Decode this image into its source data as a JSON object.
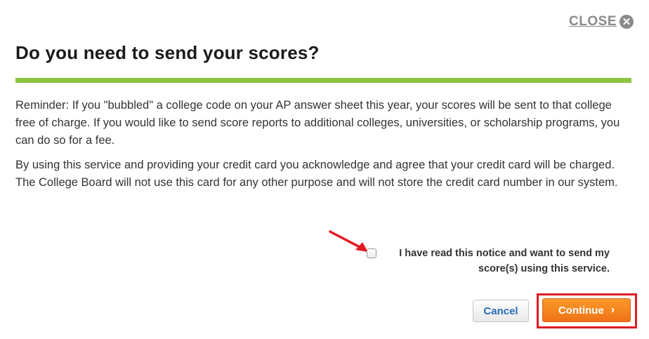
{
  "dialog": {
    "close_label": "CLOSE",
    "close_icon": "close-circle-icon",
    "title": "Do you need to send your scores?",
    "accent_color": "#8bc53f",
    "paragraphs": [
      "Reminder: If you \"bubbled\" a college code on your AP answer sheet this year, your scores will be sent to that college free of charge. If you would like to send score reports to additional colleges, universities, or scholarship programs, you can do so for a fee.",
      "By using this service and providing your credit card you acknowledge and agree that your credit card will be charged. The College Board will not use this card for any other purpose and will not store the credit card number in our system."
    ],
    "notice": {
      "label": "I have read this notice and want to send my score(s) using this service.",
      "checked": false
    },
    "buttons": {
      "cancel_label": "Cancel",
      "continue_label": "Continue",
      "continue_color": "#f7891f"
    },
    "annotations": {
      "arrow_icon": "red-arrow-icon",
      "highlight_color": "#e01b24"
    }
  }
}
